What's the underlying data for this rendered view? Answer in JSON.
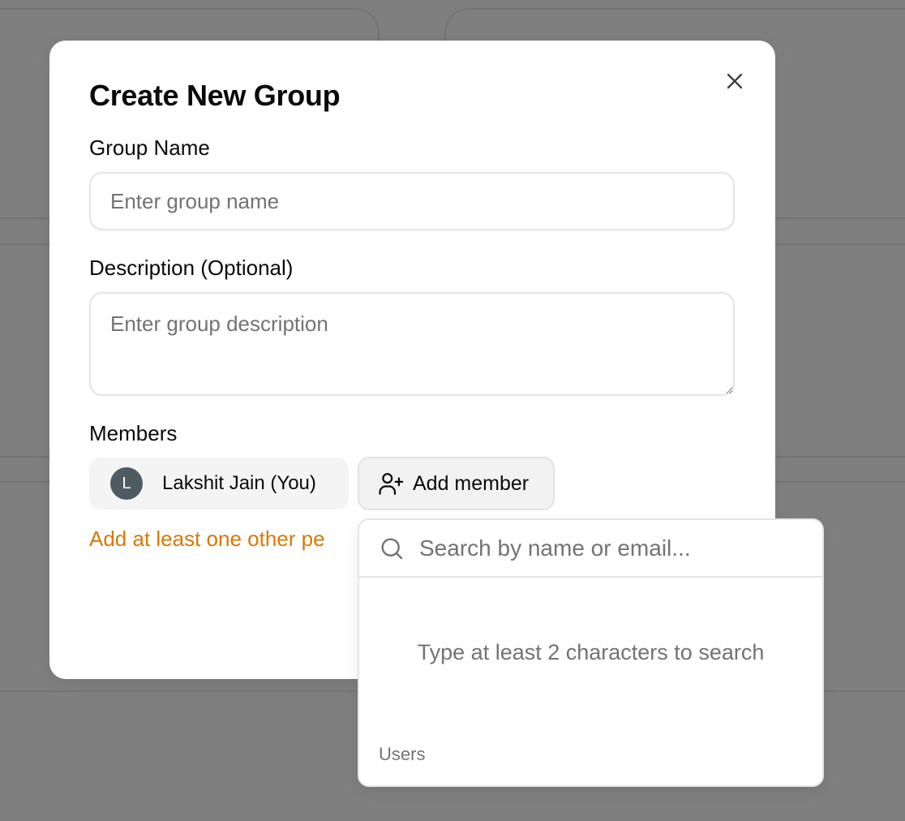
{
  "dialog": {
    "title": "Create New Group",
    "close_icon": "close-icon"
  },
  "form": {
    "group_name": {
      "label": "Group Name",
      "placeholder": "Enter group name",
      "value": ""
    },
    "description": {
      "label": "Description (Optional)",
      "placeholder": "Enter group description",
      "value": ""
    },
    "members": {
      "label": "Members",
      "list": [
        {
          "initial": "L",
          "name": "Lakshit Jain (You)"
        }
      ],
      "add_button_label": "Add member",
      "add_button_icon": "user-plus-icon",
      "warning": "Add at least one other pe",
      "warning_color": "#d97706"
    }
  },
  "member_search": {
    "icon": "search-icon",
    "placeholder": "Search by name or email...",
    "empty_message": "Type at least 2 characters to search",
    "group_heading": "Users"
  }
}
